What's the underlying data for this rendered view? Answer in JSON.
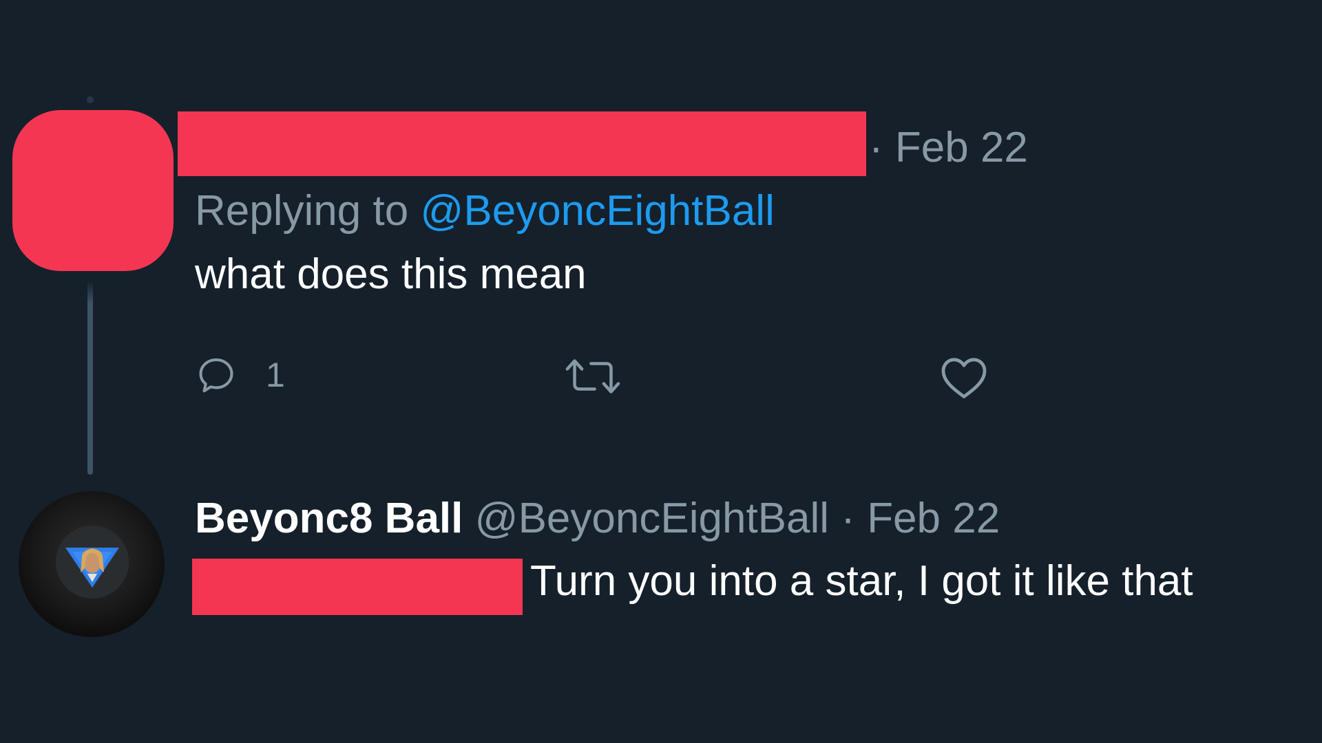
{
  "theme": {
    "background": "#15202b",
    "text_primary": "#ffffff",
    "text_secondary": "#8899a6",
    "link": "#1d9bf0",
    "redaction": "#f53653"
  },
  "reply_tweet": {
    "date": "Feb 22",
    "replying_prefix": "Replying to",
    "replying_to": "@BeyoncEightBall",
    "text": "what does this mean",
    "actions": {
      "reply_icon": "reply-icon",
      "reply_count": "1",
      "retweet_icon": "retweet-icon",
      "like_icon": "heart-icon"
    }
  },
  "bot_tweet": {
    "display_name": "Beyonc8 Ball",
    "handle": "@BeyoncEightBall",
    "date": "Feb 22",
    "text": "Turn you into a star, I got it like that"
  },
  "separator": "·"
}
